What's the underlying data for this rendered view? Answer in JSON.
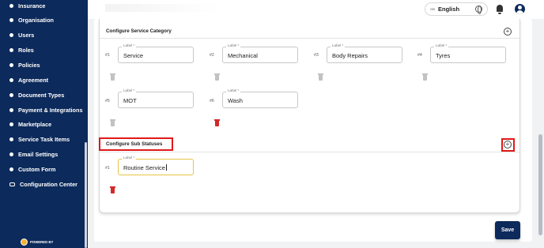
{
  "sidebar": {
    "items": [
      {
        "label": "Insurance"
      },
      {
        "label": "Organisation"
      },
      {
        "label": "Users"
      },
      {
        "label": "Roles"
      },
      {
        "label": "Policies"
      },
      {
        "label": "Agreement"
      },
      {
        "label": "Document Types"
      },
      {
        "label": "Payment & Integrations"
      },
      {
        "label": "Marketplace"
      },
      {
        "label": "Service Task Items"
      },
      {
        "label": "Email Settings"
      },
      {
        "label": "Custom Form"
      },
      {
        "label": "Configuration Center"
      }
    ],
    "powered_by": "POWERED BY"
  },
  "header": {
    "language": {
      "flag": "GB",
      "label": "English"
    }
  },
  "service_category": {
    "title": "Configure Service Category",
    "items": [
      {
        "number": "#1",
        "label": "Label *",
        "value": "Service"
      },
      {
        "number": "#2",
        "label": "Label *",
        "value": "Mechanical"
      },
      {
        "number": "#3",
        "label": "Label *",
        "value": "Body Repairs"
      },
      {
        "number": "#4",
        "label": "Label *",
        "value": "Tyres"
      },
      {
        "number": "#5",
        "label": "Label *",
        "value": "MOT"
      },
      {
        "number": "#6",
        "label": "Label *",
        "value": "Wash"
      }
    ]
  },
  "sub_statuses": {
    "title": "Configure Sub Statuses",
    "items": [
      {
        "number": "#1",
        "label": "Label *",
        "value": "Routine Service"
      }
    ]
  },
  "actions": {
    "save_label": "Save"
  },
  "colors": {
    "sidebar": "#0c2a5b",
    "highlight": "#e01919",
    "delete_active": "#d12a2a",
    "focus_border": "#e6c545"
  }
}
